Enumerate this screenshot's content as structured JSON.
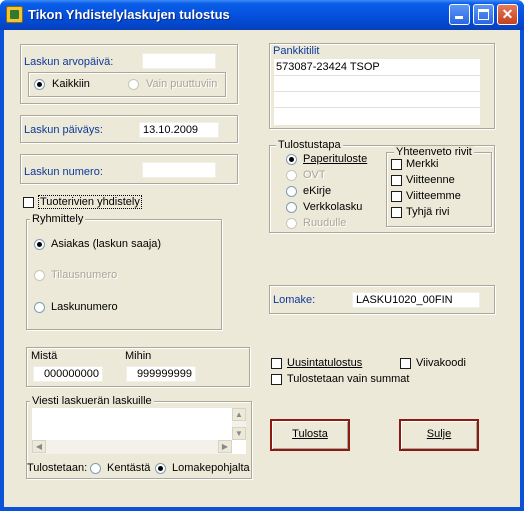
{
  "window": {
    "title": "Tikon Yhdistelylaskujen tulostus"
  },
  "invoice_value_date": {
    "label": "Laskun arvopäivä:",
    "value": "",
    "option_all": "Kaikkiin",
    "option_missing": "Vain puuttuviin"
  },
  "invoice_date": {
    "label": "Laskun päiväys:",
    "value": "13.10.2009"
  },
  "invoice_number": {
    "label": "Laskun numero:",
    "value": ""
  },
  "combine_rows": {
    "label": "Tuoterivien yhdistely"
  },
  "grouping": {
    "label": "Ryhmittely",
    "options": [
      "Asiakas (laskun saaja)",
      "Tilausnumero",
      "Laskunumero"
    ]
  },
  "range": {
    "from_label": "Mistä",
    "to_label": "Mihin",
    "from_value": "000000000",
    "to_value": "999999999"
  },
  "message": {
    "label": "Viesti laskuerän laskuille",
    "value": ""
  },
  "print_from": {
    "label": "Tulostetaan:",
    "option_field": "Kentästä",
    "option_template": "Lomakepohjalta"
  },
  "bank_accounts": {
    "label": "Pankkitilit",
    "items": [
      "573087-23424 TSOP",
      "",
      "",
      ""
    ]
  },
  "print_method": {
    "label": "Tulostustapa",
    "options": [
      "Paperituloste",
      "OVT",
      "eKirje",
      "Verkkolasku",
      "Ruudulle"
    ]
  },
  "summary_rows": {
    "label": "Yhteenveto rivit",
    "options": [
      "Merkki",
      "Viitteenne",
      "Viitteemme",
      "Tyhjä rivi"
    ]
  },
  "form": {
    "label": "Lomake:",
    "value": "LASKU1020_00FIN"
  },
  "options": {
    "reprint": "Uusintatulostus",
    "barcode": "Viivakoodi",
    "sums_only": "Tulostetaan vain summat"
  },
  "buttons": {
    "print": "Tulosta",
    "close": "Sulje"
  },
  "colors": {
    "titlebar": "#0551dd",
    "dialog_bg": "#ece9d8",
    "button_border": "#8b1a10"
  }
}
